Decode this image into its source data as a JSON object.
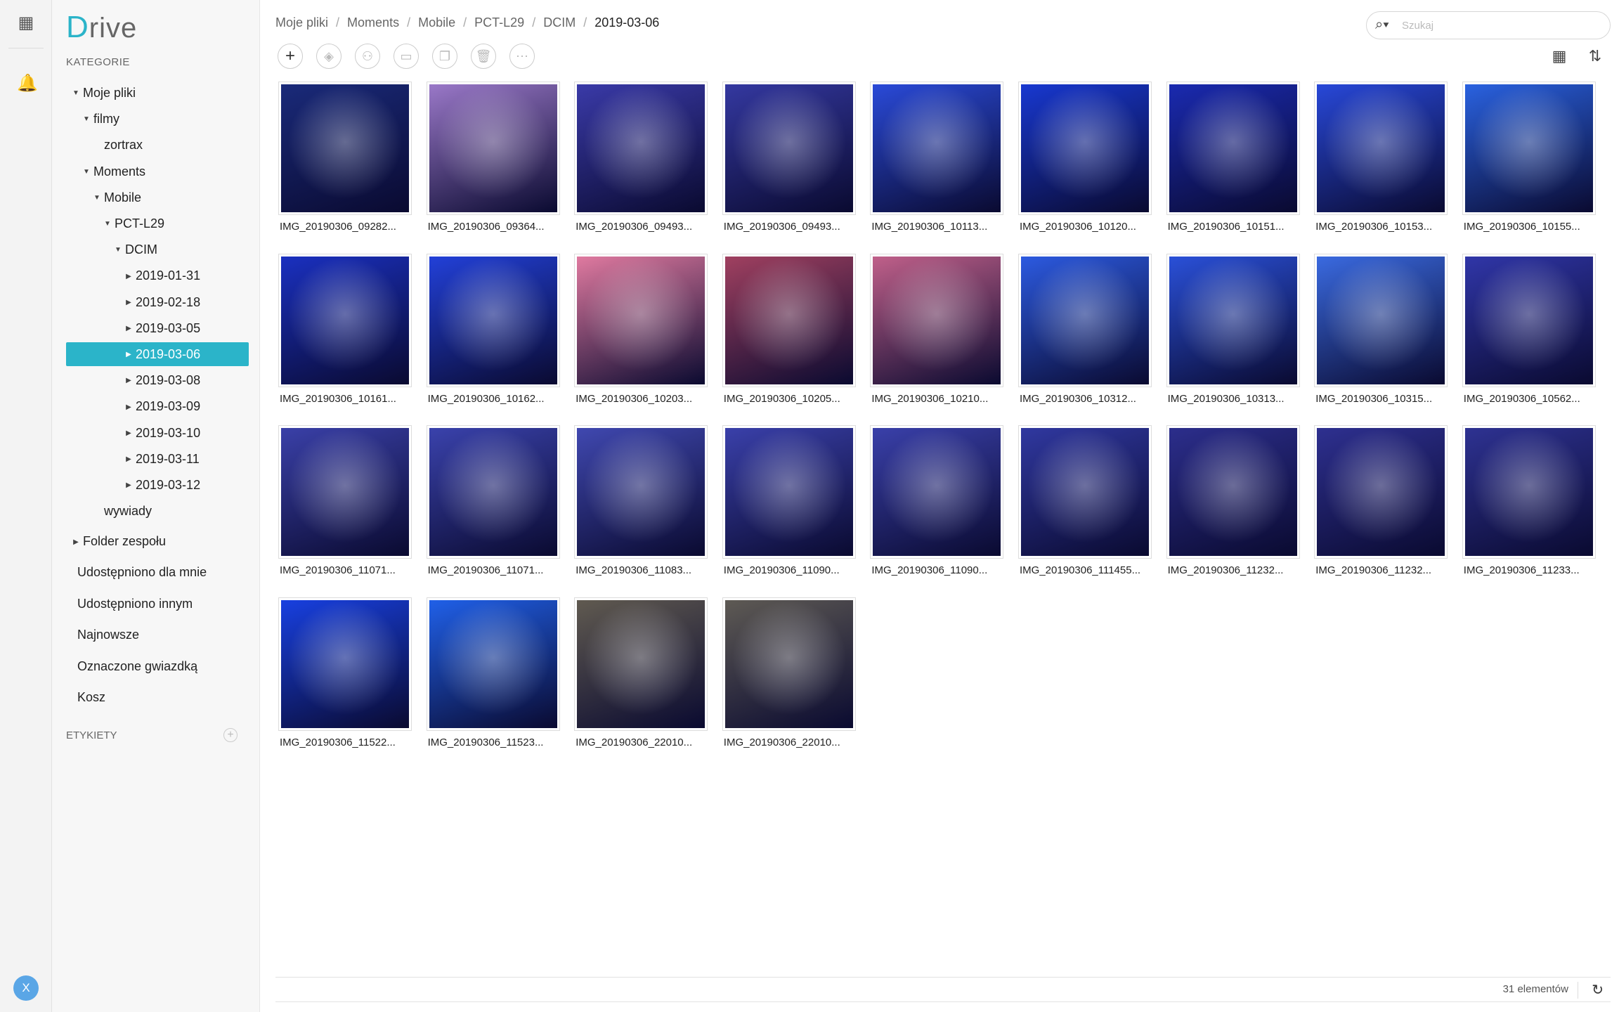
{
  "app": {
    "logo_letter": "D",
    "logo_rest": "rive"
  },
  "sidebar": {
    "categories_label": "KATEGORIE",
    "tree": [
      {
        "label": "Moje pliki",
        "depth": 0,
        "arrow": "down"
      },
      {
        "label": "filmy",
        "depth": 1,
        "arrow": "down"
      },
      {
        "label": "zortrax",
        "depth": 2,
        "arrow": "none"
      },
      {
        "label": "Moments",
        "depth": 1,
        "arrow": "down"
      },
      {
        "label": "Mobile",
        "depth": 2,
        "arrow": "down"
      },
      {
        "label": "PCT-L29",
        "depth": 3,
        "arrow": "down"
      },
      {
        "label": "DCIM",
        "depth": 4,
        "arrow": "down"
      },
      {
        "label": "2019-01-31",
        "depth": 5,
        "arrow": "right"
      },
      {
        "label": "2019-02-18",
        "depth": 5,
        "arrow": "right"
      },
      {
        "label": "2019-03-05",
        "depth": 5,
        "arrow": "right"
      },
      {
        "label": "2019-03-06",
        "depth": 5,
        "arrow": "right",
        "selected": true
      },
      {
        "label": "2019-03-08",
        "depth": 5,
        "arrow": "right"
      },
      {
        "label": "2019-03-09",
        "depth": 5,
        "arrow": "right"
      },
      {
        "label": "2019-03-10",
        "depth": 5,
        "arrow": "right"
      },
      {
        "label": "2019-03-11",
        "depth": 5,
        "arrow": "right"
      },
      {
        "label": "2019-03-12",
        "depth": 5,
        "arrow": "right"
      },
      {
        "label": "wywiady",
        "depth": 2,
        "arrow": "none"
      },
      {
        "label": "Folder zespołu",
        "depth": 0,
        "arrow": "right"
      }
    ],
    "links": [
      "Udostępniono dla mnie",
      "Udostępniono innym",
      "Najnowsze",
      "Oznaczone gwiazdką",
      "Kosz"
    ],
    "tags_label": "ETYKIETY",
    "avatar_letter": "X"
  },
  "breadcrumb": [
    "Moje pliki",
    "Moments",
    "Mobile",
    "PCT-L29",
    "DCIM",
    "2019-03-06"
  ],
  "search": {
    "placeholder": "Szukaj",
    "value": ""
  },
  "toolbar": {
    "buttons": [
      {
        "name": "add-button",
        "icon": "plus-icon",
        "glyph": "+",
        "enabled": true
      },
      {
        "name": "tag-button",
        "icon": "tag-icon",
        "glyph": "◈",
        "enabled": false
      },
      {
        "name": "share-button",
        "icon": "add-user-icon",
        "glyph": "⚇",
        "enabled": false
      },
      {
        "name": "move-button",
        "icon": "folder-move-icon",
        "glyph": "▭",
        "enabled": false
      },
      {
        "name": "copy-button",
        "icon": "copy-icon",
        "glyph": "❐",
        "enabled": false
      },
      {
        "name": "delete-button",
        "icon": "trash-icon",
        "glyph": "🗑",
        "enabled": false
      },
      {
        "name": "more-button",
        "icon": "more-icon",
        "glyph": "⋯",
        "enabled": false
      }
    ]
  },
  "files": [
    {
      "name": "IMG_20190306_09282...",
      "color": "#1a2a7a"
    },
    {
      "name": "IMG_20190306_09364...",
      "color": "#9a78c8"
    },
    {
      "name": "IMG_20190306_09493...",
      "color": "#3a3aa8"
    },
    {
      "name": "IMG_20190306_09493...",
      "color": "#3438a0"
    },
    {
      "name": "IMG_20190306_10113...",
      "color": "#2a4ad8"
    },
    {
      "name": "IMG_20190306_10120...",
      "color": "#1838d0"
    },
    {
      "name": "IMG_20190306_10151...",
      "color": "#1a2ab0"
    },
    {
      "name": "IMG_20190306_10153...",
      "color": "#2848d8"
    },
    {
      "name": "IMG_20190306_10155...",
      "color": "#2a62e0"
    },
    {
      "name": "IMG_20190306_10161...",
      "color": "#1a30c0"
    },
    {
      "name": "IMG_20190306_10162...",
      "color": "#2240d8"
    },
    {
      "name": "IMG_20190306_10203...",
      "color": "#e07aa0"
    },
    {
      "name": "IMG_20190306_10205...",
      "color": "#a04060"
    },
    {
      "name": "IMG_20190306_10210...",
      "color": "#c0608a"
    },
    {
      "name": "IMG_20190306_10312...",
      "color": "#2c5ae0"
    },
    {
      "name": "IMG_20190306_10313...",
      "color": "#2a50d8"
    },
    {
      "name": "IMG_20190306_10315...",
      "color": "#3a6ae0"
    },
    {
      "name": "IMG_20190306_10562...",
      "color": "#3036a8"
    },
    {
      "name": "IMG_20190306_11071...",
      "color": "#3a40a8"
    },
    {
      "name": "IMG_20190306_11071...",
      "color": "#3a42ac"
    },
    {
      "name": "IMG_20190306_11083...",
      "color": "#4048b0"
    },
    {
      "name": "IMG_20190306_11090...",
      "color": "#3a40aa"
    },
    {
      "name": "IMG_20190306_11090...",
      "color": "#3a40aa"
    },
    {
      "name": "IMG_20190306_111455...",
      "color": "#3038a0"
    },
    {
      "name": "IMG_20190306_11232...",
      "color": "#2c2e8c"
    },
    {
      "name": "IMG_20190306_11232...",
      "color": "#2e3090"
    },
    {
      "name": "IMG_20190306_11233...",
      "color": "#2e3292"
    },
    {
      "name": "IMG_20190306_11522...",
      "color": "#1840e0"
    },
    {
      "name": "IMG_20190306_11523...",
      "color": "#2060e8"
    },
    {
      "name": "IMG_20190306_22010...",
      "color": "#605a50"
    },
    {
      "name": "IMG_20190306_22010...",
      "color": "#5e5a54"
    }
  ],
  "footer": {
    "count": "31 elementów"
  }
}
